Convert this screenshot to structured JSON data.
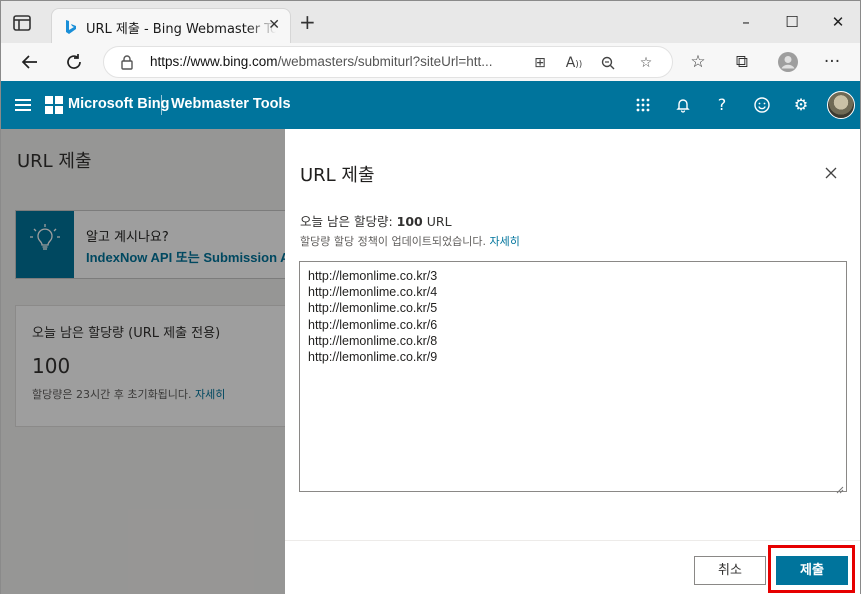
{
  "browser": {
    "tab_title": "URL 제출 - Bing Webmaster Tools",
    "url_host": "https://www.bing.com",
    "url_path": "/webmasters/submiturl?siteUrl=htt..."
  },
  "header": {
    "brand": "Microsoft Bing",
    "product": "Webmaster Tools",
    "icons": [
      "apps-icon",
      "bell-icon",
      "help-icon",
      "smiley-icon",
      "gear-icon"
    ]
  },
  "page": {
    "title": "URL 제출",
    "info_title": "알고 계시나요?",
    "info_body": "IndexNow API 또는 Submission API",
    "quota_title": "오늘 남은 할당량 (URL 제출 전용)",
    "quota_value": "100",
    "quota_note": "할당량은 23시간 후 초기화됩니다.",
    "quota_note_link": "자세히"
  },
  "panel": {
    "title": "URL 제출",
    "quota_label": "오늘 남은 할당량:",
    "quota_value": "100",
    "quota_unit": "URL",
    "policy_text": "할당량 할당 정책이 업데이트되었습니다.",
    "policy_link": "자세히",
    "urls": "http://lemonlime.co.kr/3\nhttp://lemonlime.co.kr/4\nhttp://lemonlime.co.kr/5\nhttp://lemonlime.co.kr/6\nhttp://lemonlime.co.kr/8\nhttp://lemonlime.co.kr/9",
    "cancel_label": "취소",
    "submit_label": "제출"
  },
  "colors": {
    "brand": "#00749c",
    "highlight": "#e60000"
  }
}
